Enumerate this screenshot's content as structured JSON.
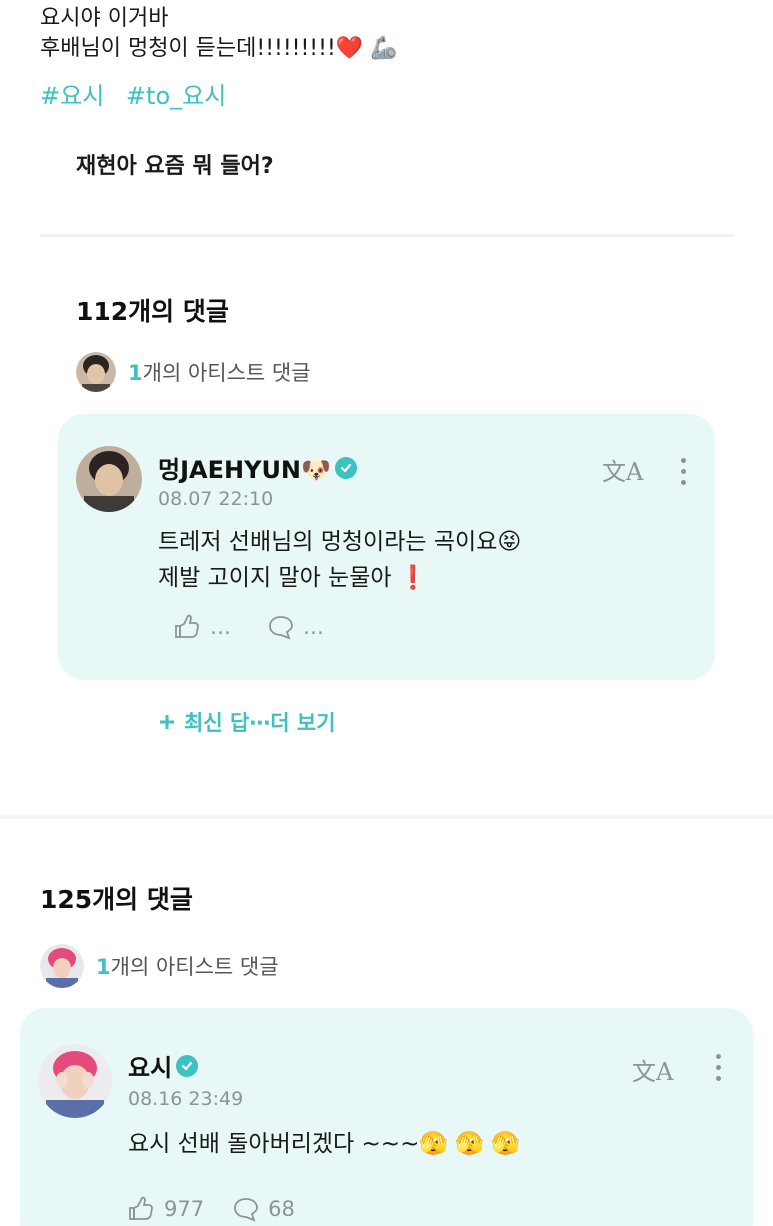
{
  "post": {
    "line1": "요시야 이거바",
    "line2": "후배님이 멍청이 듣는데!!!!!!!!!❤️ 🦾",
    "hashtags": [
      "#요시",
      "#to_요시"
    ],
    "quote": "재현아 요즘 뭐 들어?"
  },
  "section1": {
    "title": "112개의 댓글",
    "artist_count": "1",
    "artist_label": "개의 아티스트 댓글",
    "comment": {
      "name": "멍JAEHYUN🐶",
      "time": "08.07 22:10",
      "line1": "트레저 선배님의 멍청이라는 곡이요😝",
      "line2": "제발 고이지 말아 눈물아 ❗",
      "likes": "…",
      "replies": "…",
      "translate_icon": "文A"
    },
    "more_replies": "최신 답⋯더 보기"
  },
  "section2": {
    "title": "125개의 댓글",
    "artist_count": "1",
    "artist_label": "개의 아티스트 댓글",
    "comment": {
      "name": "요시",
      "time": "08.16 23:49",
      "text": "요시 선배 돌아버리겠다 ~~~🫣 🫣 🫣",
      "likes": "977",
      "replies": "68",
      "translate_icon": "文A"
    }
  },
  "colors": {
    "accent": "#3ec1c1",
    "card_bg": "#e8f8f6",
    "muted": "#8d9499"
  }
}
